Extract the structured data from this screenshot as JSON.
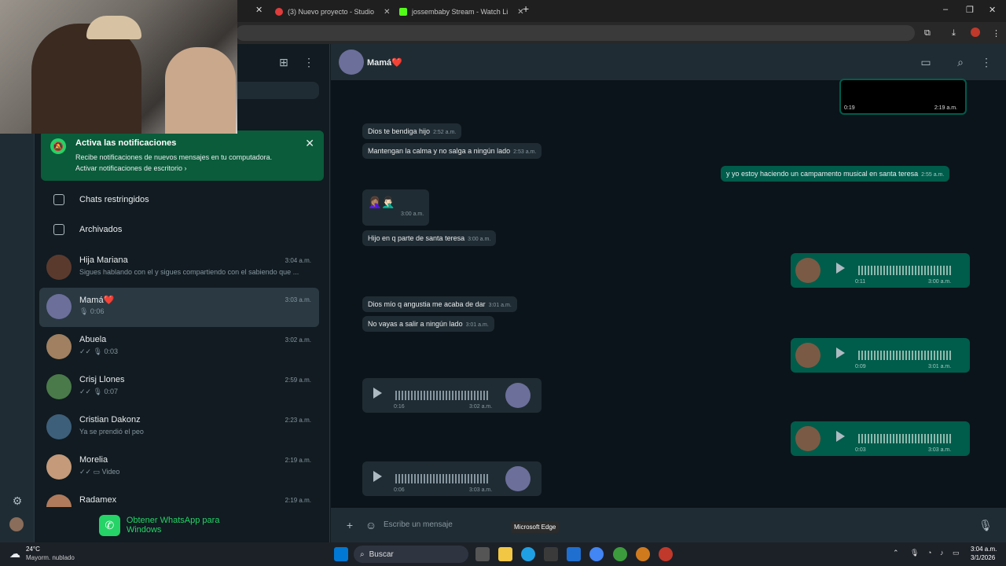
{
  "browser": {
    "tabs": [
      {
        "label": "(3) Nuevo proyecto - Studio"
      },
      {
        "label": "jossembaby Stream - Watch Li"
      }
    ],
    "tooltip": "Microsoft Edge"
  },
  "sidebar": {
    "notification": {
      "title": "Activa las notificaciones",
      "desc": "Recibe notificaciones de nuevos mensajes en tu computadora.",
      "link": "Activar notificaciones de escritorio ›"
    },
    "restricted": "Chats restringidos",
    "archived": "Archivados",
    "chats": [
      {
        "name": "Hija Mariana",
        "time": "3:04 a.m.",
        "preview": "Sigues hablando con el y sigues compartiendo con el sabiendo que ..."
      },
      {
        "name": "Mamá❤️",
        "time": "3:03 a.m.",
        "preview": "🎙 0:06"
      },
      {
        "name": "Abuela",
        "time": "3:02 a.m.",
        "preview": "✓✓ 🎙 0:03"
      },
      {
        "name": "Crisj Llones",
        "time": "2:59 a.m.",
        "preview": "✓✓ 🎙 0:07"
      },
      {
        "name": "Cristian Dakonz",
        "time": "2:23 a.m.",
        "preview": "Ya se prendió el peo"
      },
      {
        "name": "Morelia",
        "time": "2:19 a.m.",
        "preview": "✓✓ ▭ Video"
      },
      {
        "name": "Radamex",
        "time": "2:19 a.m.",
        "preview": ""
      }
    ],
    "get_whatsapp": "Obtener WhatsApp para Windows"
  },
  "conversation": {
    "contact": "Mamá❤️",
    "video_duration": "0:19",
    "video_time": "2:19 a.m.",
    "messages": [
      {
        "text": "Dios te bendiga hijo",
        "time": "2:52 a.m."
      },
      {
        "text": "Mantengan la calma y no salga a ningún lado",
        "time": "2:53 a.m."
      },
      {
        "text": "y yo estoy haciendo un campamento musical en santa teresa",
        "time": "2:55 a.m."
      },
      {
        "text": "🤦🏽‍♀️🤦🏻‍♂️",
        "time": "3:00 a.m."
      },
      {
        "text": "Hijo en q parte de santa teresa",
        "time": "3:00 a.m."
      },
      {
        "text": "Dios mío q angustia me acaba de dar",
        "time": "3:01 a.m."
      },
      {
        "text": "No vayas a salir a ningún lado",
        "time": "3:01 a.m."
      }
    ],
    "voices": [
      {
        "duration": "0:11",
        "time": "3:00 a.m."
      },
      {
        "duration": "0:09",
        "time": "3:01 a.m."
      },
      {
        "duration": "0:16",
        "time": "3:02 a.m."
      },
      {
        "duration": "0:03",
        "time": "3:03 a.m."
      },
      {
        "duration": "0:06",
        "time": "3:03 a.m."
      }
    ],
    "input_placeholder": "Escribe un mensaje"
  },
  "taskbar": {
    "weather_temp": "24°C",
    "weather_desc": "Mayorm. nublado",
    "search": "Buscar",
    "time": "3:04 a.m.",
    "date": "3/1/2026"
  }
}
